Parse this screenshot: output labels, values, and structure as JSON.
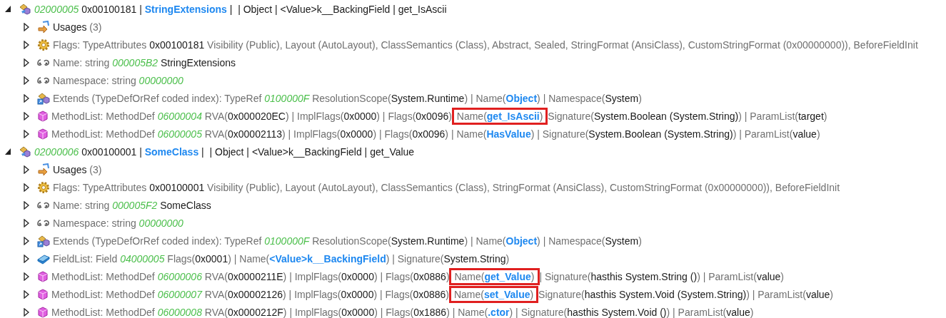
{
  "tree": [
    {
      "kind": "class",
      "expanded": true,
      "segments": [
        {
          "kind": "id",
          "text": "02000005"
        },
        {
          "kind": "value",
          "text": " 0x00100181 | "
        },
        {
          "kind": "name",
          "text": "StringExtensions"
        },
        {
          "kind": "value",
          "text": " |  | Object | <Value>k__BackingField | get_IsAscii"
        }
      ],
      "children": [
        {
          "kind": "usages",
          "expanded": false,
          "segments": [
            {
              "kind": "value",
              "text": "Usages "
            },
            {
              "kind": "label",
              "text": "(3)"
            }
          ]
        },
        {
          "kind": "flags",
          "expanded": false,
          "segments": [
            {
              "kind": "label",
              "text": "Flags: TypeAttributes "
            },
            {
              "kind": "value",
              "text": "0x00100181"
            },
            {
              "kind": "label",
              "text": " Visibility (Public), Layout (AutoLayout), ClassSemantics (Class), Abstract, Sealed, StringFormat (AnsiClass), CustomStringFormat (0x00000000)), BeforeFieldInit"
            }
          ]
        },
        {
          "kind": "string",
          "expanded": false,
          "segments": [
            {
              "kind": "label",
              "text": "Name: string "
            },
            {
              "kind": "id",
              "text": "000005B2"
            },
            {
              "kind": "value",
              "text": " StringExtensions"
            }
          ]
        },
        {
          "kind": "string",
          "expanded": false,
          "segments": [
            {
              "kind": "label",
              "text": "Namespace: string "
            },
            {
              "kind": "id",
              "text": "00000000"
            }
          ]
        },
        {
          "kind": "extends",
          "expanded": false,
          "segments": [
            {
              "kind": "label",
              "text": "Extends (TypeDefOrRef coded index): TypeRef "
            },
            {
              "kind": "id",
              "text": "0100000F"
            },
            {
              "kind": "label",
              "text": " ResolutionScope("
            },
            {
              "kind": "value",
              "text": "System.Runtime"
            },
            {
              "kind": "label",
              "text": ") | Name("
            },
            {
              "kind": "name",
              "text": "Object"
            },
            {
              "kind": "label",
              "text": ") | Namespace("
            },
            {
              "kind": "value",
              "text": "System"
            },
            {
              "kind": "label",
              "text": ")"
            }
          ]
        },
        {
          "kind": "method",
          "expanded": false,
          "segments": [
            {
              "kind": "label",
              "text": "MethodList: MethodDef "
            },
            {
              "kind": "id",
              "text": "06000004"
            },
            {
              "kind": "label",
              "text": " RVA("
            },
            {
              "kind": "value",
              "text": "0x000020EC"
            },
            {
              "kind": "label",
              "text": ") | ImplFlags("
            },
            {
              "kind": "value",
              "text": "0x0000"
            },
            {
              "kind": "label",
              "text": ") | Flags("
            },
            {
              "kind": "value",
              "text": "0x0096"
            },
            {
              "kind": "label",
              "text": ") "
            },
            {
              "kind": "highlight",
              "parts": [
                {
                  "kind": "label",
                  "text": "Name("
                },
                {
                  "kind": "name",
                  "text": "get_IsAscii"
                },
                {
                  "kind": "label",
                  "text": ")"
                }
              ]
            },
            {
              "kind": "label",
              "text": " Signature("
            },
            {
              "kind": "value",
              "text": "System.Boolean (System.String)"
            },
            {
              "kind": "label",
              "text": ") | ParamList("
            },
            {
              "kind": "value",
              "text": "target"
            },
            {
              "kind": "label",
              "text": ")"
            }
          ]
        },
        {
          "kind": "method",
          "expanded": false,
          "segments": [
            {
              "kind": "label",
              "text": "MethodList: MethodDef "
            },
            {
              "kind": "id",
              "text": "06000005"
            },
            {
              "kind": "label",
              "text": " RVA("
            },
            {
              "kind": "value",
              "text": "0x00002113"
            },
            {
              "kind": "label",
              "text": ") | ImplFlags("
            },
            {
              "kind": "value",
              "text": "0x0000"
            },
            {
              "kind": "label",
              "text": ") | Flags("
            },
            {
              "kind": "value",
              "text": "0x0096"
            },
            {
              "kind": "label",
              "text": ") | Name("
            },
            {
              "kind": "name",
              "text": "HasValue"
            },
            {
              "kind": "label",
              "text": ") | Signature("
            },
            {
              "kind": "value",
              "text": "System.Boolean (System.String)"
            },
            {
              "kind": "label",
              "text": ") | ParamList("
            },
            {
              "kind": "value",
              "text": "value"
            },
            {
              "kind": "label",
              "text": ")"
            }
          ]
        }
      ]
    },
    {
      "kind": "class",
      "expanded": true,
      "segments": [
        {
          "kind": "id",
          "text": "02000006"
        },
        {
          "kind": "value",
          "text": " 0x00100001 | "
        },
        {
          "kind": "name",
          "text": "SomeClass"
        },
        {
          "kind": "value",
          "text": " |  | Object | <Value>k__BackingField | get_Value"
        }
      ],
      "children": [
        {
          "kind": "usages",
          "expanded": false,
          "segments": [
            {
              "kind": "value",
              "text": "Usages "
            },
            {
              "kind": "label",
              "text": "(3)"
            }
          ]
        },
        {
          "kind": "flags",
          "expanded": false,
          "segments": [
            {
              "kind": "label",
              "text": "Flags: TypeAttributes "
            },
            {
              "kind": "value",
              "text": "0x00100001"
            },
            {
              "kind": "label",
              "text": " Visibility (Public), Layout (AutoLayout), ClassSemantics (Class), StringFormat (AnsiClass), CustomStringFormat (0x00000000)), BeforeFieldInit"
            }
          ]
        },
        {
          "kind": "string",
          "expanded": false,
          "segments": [
            {
              "kind": "label",
              "text": "Name: string "
            },
            {
              "kind": "id",
              "text": "000005F2"
            },
            {
              "kind": "value",
              "text": " SomeClass"
            }
          ]
        },
        {
          "kind": "string",
          "expanded": false,
          "segments": [
            {
              "kind": "label",
              "text": "Namespace: string "
            },
            {
              "kind": "id",
              "text": "00000000"
            }
          ]
        },
        {
          "kind": "extends",
          "expanded": false,
          "segments": [
            {
              "kind": "label",
              "text": "Extends (TypeDefOrRef coded index): TypeRef "
            },
            {
              "kind": "id",
              "text": "0100000F"
            },
            {
              "kind": "label",
              "text": " ResolutionScope("
            },
            {
              "kind": "value",
              "text": "System.Runtime"
            },
            {
              "kind": "label",
              "text": ") | Name("
            },
            {
              "kind": "name",
              "text": "Object"
            },
            {
              "kind": "label",
              "text": ") | Namespace("
            },
            {
              "kind": "value",
              "text": "System"
            },
            {
              "kind": "label",
              "text": ")"
            }
          ]
        },
        {
          "kind": "field",
          "expanded": false,
          "segments": [
            {
              "kind": "label",
              "text": "FieldList: Field "
            },
            {
              "kind": "id",
              "text": "04000005"
            },
            {
              "kind": "label",
              "text": " Flags("
            },
            {
              "kind": "value",
              "text": "0x0001"
            },
            {
              "kind": "label",
              "text": ") | Name("
            },
            {
              "kind": "name",
              "text": "<Value>k__BackingField"
            },
            {
              "kind": "label",
              "text": ") | Signature("
            },
            {
              "kind": "value",
              "text": "System.String"
            },
            {
              "kind": "label",
              "text": ")"
            }
          ]
        },
        {
          "kind": "method",
          "expanded": false,
          "segments": [
            {
              "kind": "label",
              "text": "MethodList: MethodDef "
            },
            {
              "kind": "id",
              "text": "06000006"
            },
            {
              "kind": "label",
              "text": " RVA("
            },
            {
              "kind": "value",
              "text": "0x0000211E"
            },
            {
              "kind": "label",
              "text": ") | ImplFlags("
            },
            {
              "kind": "value",
              "text": "0x0000"
            },
            {
              "kind": "label",
              "text": ") | Flags("
            },
            {
              "kind": "value",
              "text": "0x0886"
            },
            {
              "kind": "label",
              "text": ") "
            },
            {
              "kind": "highlight",
              "parts": [
                {
                  "kind": "label",
                  "text": "Name("
                },
                {
                  "kind": "name",
                  "text": "get_Value"
                },
                {
                  "kind": "label",
                  "text": ")"
                }
              ]
            },
            {
              "kind": "label",
              "text": " | Signature("
            },
            {
              "kind": "value",
              "text": "hasthis System.String ()"
            },
            {
              "kind": "label",
              "text": ") | ParamList("
            },
            {
              "kind": "value",
              "text": "value"
            },
            {
              "kind": "label",
              "text": ")"
            }
          ]
        },
        {
          "kind": "method",
          "expanded": false,
          "segments": [
            {
              "kind": "label",
              "text": "MethodList: MethodDef "
            },
            {
              "kind": "id",
              "text": "06000007"
            },
            {
              "kind": "label",
              "text": " RVA("
            },
            {
              "kind": "value",
              "text": "0x00002126"
            },
            {
              "kind": "label",
              "text": ") | ImplFlags("
            },
            {
              "kind": "value",
              "text": "0x0000"
            },
            {
              "kind": "label",
              "text": ") | Flags("
            },
            {
              "kind": "value",
              "text": "0x0886"
            },
            {
              "kind": "label",
              "text": ") "
            },
            {
              "kind": "highlight",
              "parts": [
                {
                  "kind": "label",
                  "text": "Name("
                },
                {
                  "kind": "name",
                  "text": "set_Value"
                },
                {
                  "kind": "label",
                  "text": ")"
                }
              ]
            },
            {
              "kind": "label",
              "text": " Signature("
            },
            {
              "kind": "value",
              "text": "hasthis System.Void (System.String)"
            },
            {
              "kind": "label",
              "text": ") | ParamList("
            },
            {
              "kind": "value",
              "text": "value"
            },
            {
              "kind": "label",
              "text": ")"
            }
          ]
        },
        {
          "kind": "method",
          "expanded": false,
          "segments": [
            {
              "kind": "label",
              "text": "MethodList: MethodDef "
            },
            {
              "kind": "id",
              "text": "06000008"
            },
            {
              "kind": "label",
              "text": " RVA("
            },
            {
              "kind": "value",
              "text": "0x0000212F"
            },
            {
              "kind": "label",
              "text": ") | ImplFlags("
            },
            {
              "kind": "value",
              "text": "0x0000"
            },
            {
              "kind": "label",
              "text": ") | Flags("
            },
            {
              "kind": "value",
              "text": "0x1886"
            },
            {
              "kind": "label",
              "text": ") | Name("
            },
            {
              "kind": "name",
              "text": ".ctor"
            },
            {
              "kind": "label",
              "text": ") | Signature("
            },
            {
              "kind": "value",
              "text": "hasthis System.Void ()"
            },
            {
              "kind": "label",
              "text": ") | ParamList("
            },
            {
              "kind": "value",
              "text": "value"
            },
            {
              "kind": "label",
              "text": ")"
            }
          ]
        }
      ]
    }
  ]
}
